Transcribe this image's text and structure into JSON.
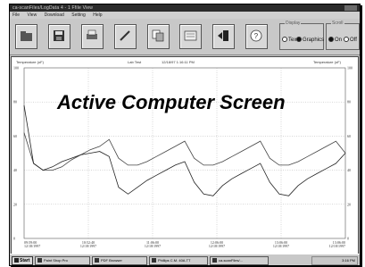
{
  "window": {
    "title": "ca-scanFiles/LogData 4 - 1 Ffile View"
  },
  "menu": {
    "items": [
      "File",
      "View",
      "Download",
      "Setting",
      "Help"
    ]
  },
  "toolbar": {
    "buttons": [
      "folder-icon",
      "save-icon",
      "print-icon",
      "pen-icon",
      "copy-icon",
      "document-icon",
      "export-icon",
      "help-icon"
    ]
  },
  "display_group": {
    "legend": "Display",
    "opt_text": "Text",
    "opt_graphics": "Graphics",
    "selected": "Graphics"
  },
  "scroll_group": {
    "legend": "Scroll",
    "opt_on": "On",
    "opt_off": "Off",
    "selected": "On"
  },
  "plot": {
    "left_header": "Temperature (oF)",
    "center_header": "Lab Test",
    "date_header": "12/18/97  1:16:11 PM",
    "right_header": "Temperature (oF)",
    "yticks": [
      "100",
      "80",
      "60",
      "40",
      "20",
      "0"
    ],
    "xticks": [
      [
        "09:59:00",
        "12/18/1997"
      ],
      [
        "10:52:40",
        "12/18/1997"
      ],
      [
        "11:06:00",
        "12/18/1997"
      ],
      [
        "12:06:00",
        "12/18/1997"
      ],
      [
        "13:06:00",
        "12/18/1997"
      ],
      [
        "13:06:00",
        "12/18/1997"
      ]
    ]
  },
  "overlay_caption": "Active Computer Screen",
  "taskbar": {
    "start": "Start",
    "tasks": [
      "Paint Shop Pro",
      "PDF Browser",
      "Phillips C.M. 40A.TT",
      "ca-scanFiles/..."
    ],
    "clock": "3:16 PM"
  },
  "chart_data": {
    "type": "line",
    "ylim": [
      0,
      100
    ],
    "series": [
      {
        "values": [
          62,
          44,
          40,
          40,
          42,
          46,
          49,
          52,
          54,
          58,
          47,
          43,
          43,
          45,
          48,
          51,
          54,
          57,
          47,
          43,
          43,
          45,
          48,
          51,
          54,
          57,
          47,
          43,
          43,
          45,
          48,
          51,
          54,
          57,
          50
        ]
      },
      {
        "values": [
          78,
          44,
          40,
          42,
          45,
          47,
          49,
          50,
          51,
          48,
          30,
          26,
          30,
          34,
          37,
          40,
          43,
          45,
          33,
          26,
          25,
          31,
          35,
          38,
          41,
          44,
          33,
          26,
          25,
          31,
          35,
          38,
          41,
          44,
          50
        ]
      }
    ]
  }
}
